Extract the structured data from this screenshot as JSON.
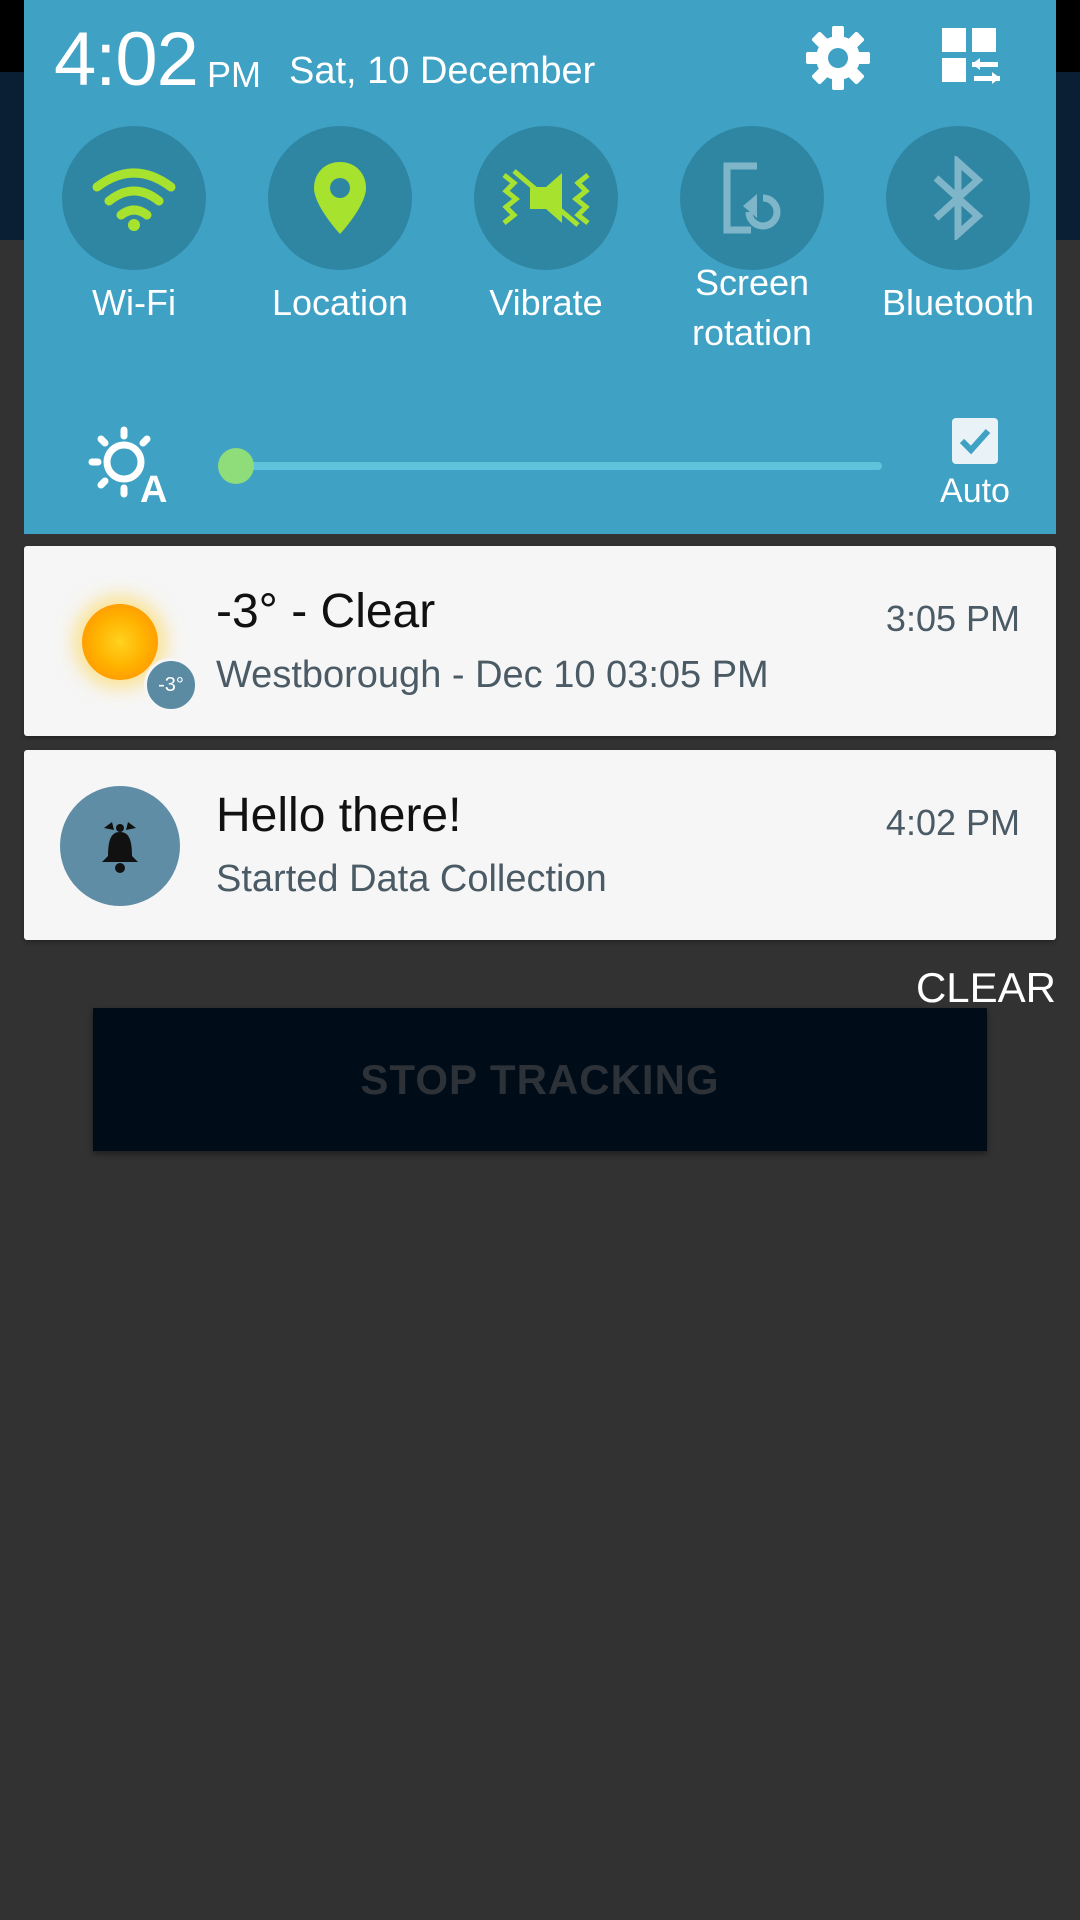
{
  "shade": {
    "time": "4:02",
    "ampm": "PM",
    "date": "Sat, 10 December",
    "tiles": [
      {
        "label": "Wi-Fi",
        "icon": "wifi-icon",
        "active": true
      },
      {
        "label": "Location",
        "icon": "location-pin-icon",
        "active": true
      },
      {
        "label": "Vibrate",
        "icon": "vibrate-icon",
        "active": true
      },
      {
        "label": "Screen rotation",
        "icon": "screen-rotation-icon",
        "active": false
      },
      {
        "label": "Bluetooth",
        "icon": "bluetooth-icon",
        "active": false
      }
    ],
    "brightness": {
      "level": 0.0,
      "auto_label": "Auto",
      "auto_checked": true
    }
  },
  "notifications": [
    {
      "title": "-3° -  Clear",
      "subtitle": "Westborough - Dec 10  03:05 PM",
      "time": "3:05 PM",
      "badge": "-3°",
      "icon": "sun-icon"
    },
    {
      "title": "Hello there!",
      "subtitle": "Started Data Collection",
      "time": "4:02 PM",
      "icon": "bell-icon"
    }
  ],
  "clear_label": "CLEAR",
  "app": {
    "stop_button": "STOP TRACKING"
  },
  "colors": {
    "shade_bg": "#3fa1c4",
    "active_icon": "#a6e22e",
    "inactive_icon": "#7fb5c8"
  }
}
